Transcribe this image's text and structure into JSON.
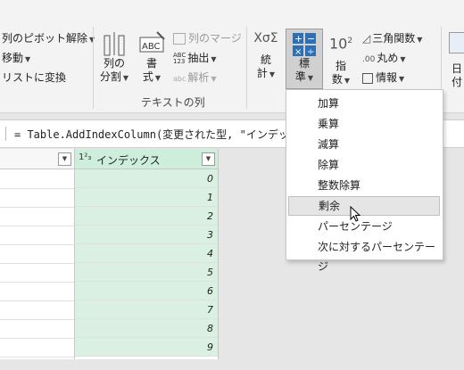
{
  "ribbon": {
    "left_items": [
      {
        "label": "列のピボット解除",
        "dropdown": true
      },
      {
        "label": "移動",
        "dropdown": true
      },
      {
        "label": "リストに変換",
        "dropdown": false
      }
    ],
    "split_column": {
      "line1": "列の",
      "line2": "分割"
    },
    "format": {
      "line1": "書",
      "line2": "式"
    },
    "merge_columns": "列のマージ",
    "extract": "抽出",
    "parse": "解析",
    "text_group_label": "テキストの列",
    "statistics": {
      "line1": "統",
      "line2": "計"
    },
    "standard": {
      "line1": "標",
      "line2": "準"
    },
    "scientific": {
      "line1": "指",
      "line2": "数"
    },
    "trig": "三角関数",
    "rounding": "丸め",
    "information": "情報",
    "right_cut": {
      "line1": "日",
      "line2": "付"
    }
  },
  "formula_bar": {
    "text": "= Table.AddIndexColumn(変更された型, \"インデック"
  },
  "grid": {
    "index_header": "インデックス",
    "index_type_icon": "1²₃",
    "rows": [
      "0",
      "1",
      "2",
      "3",
      "4",
      "5",
      "6",
      "7",
      "8",
      "9"
    ]
  },
  "menu": {
    "items": [
      "加算",
      "乗算",
      "減算",
      "除算",
      "整数除算",
      "剰余",
      "パーセンテージ",
      "次に対するパーセンテージ"
    ],
    "hover_index": 5
  }
}
